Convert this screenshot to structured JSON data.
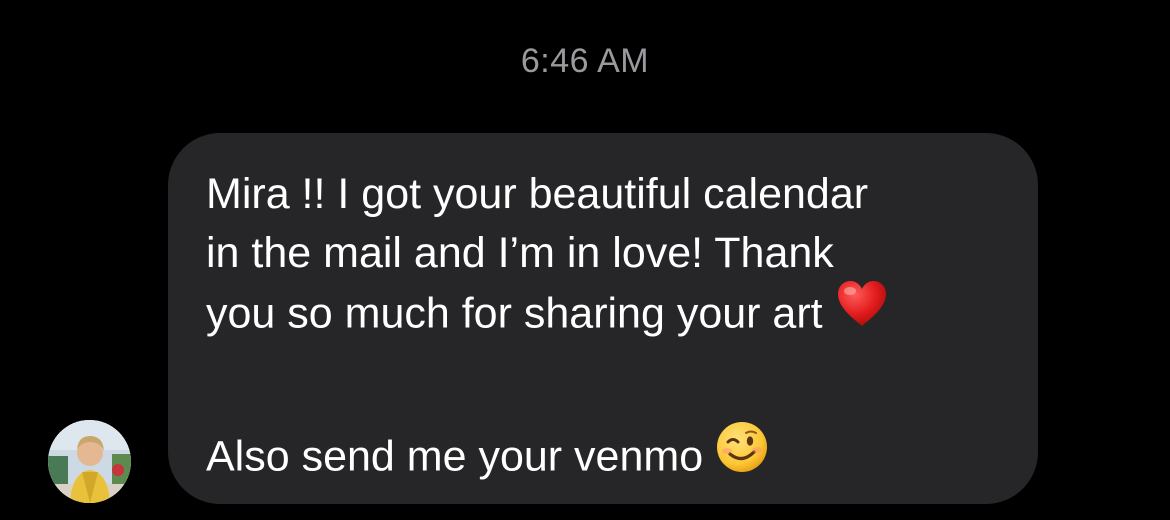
{
  "conversation": {
    "timestamp": "6:46 AM",
    "message": {
      "lines": [
        "Mira !! I got your beautiful calendar",
        "in the mail and I’m in love! Thank",
        "you so much for sharing your art"
      ],
      "line2": "Also send me your venmo",
      "emoji_1": "red-heart-icon",
      "emoji_2": "winking-face-icon"
    },
    "sender_avatar": "contact-avatar-photo"
  },
  "colors": {
    "background": "#000000",
    "bubble": "#262628",
    "text": "#ffffff",
    "timestamp": "#9a9a9e"
  }
}
